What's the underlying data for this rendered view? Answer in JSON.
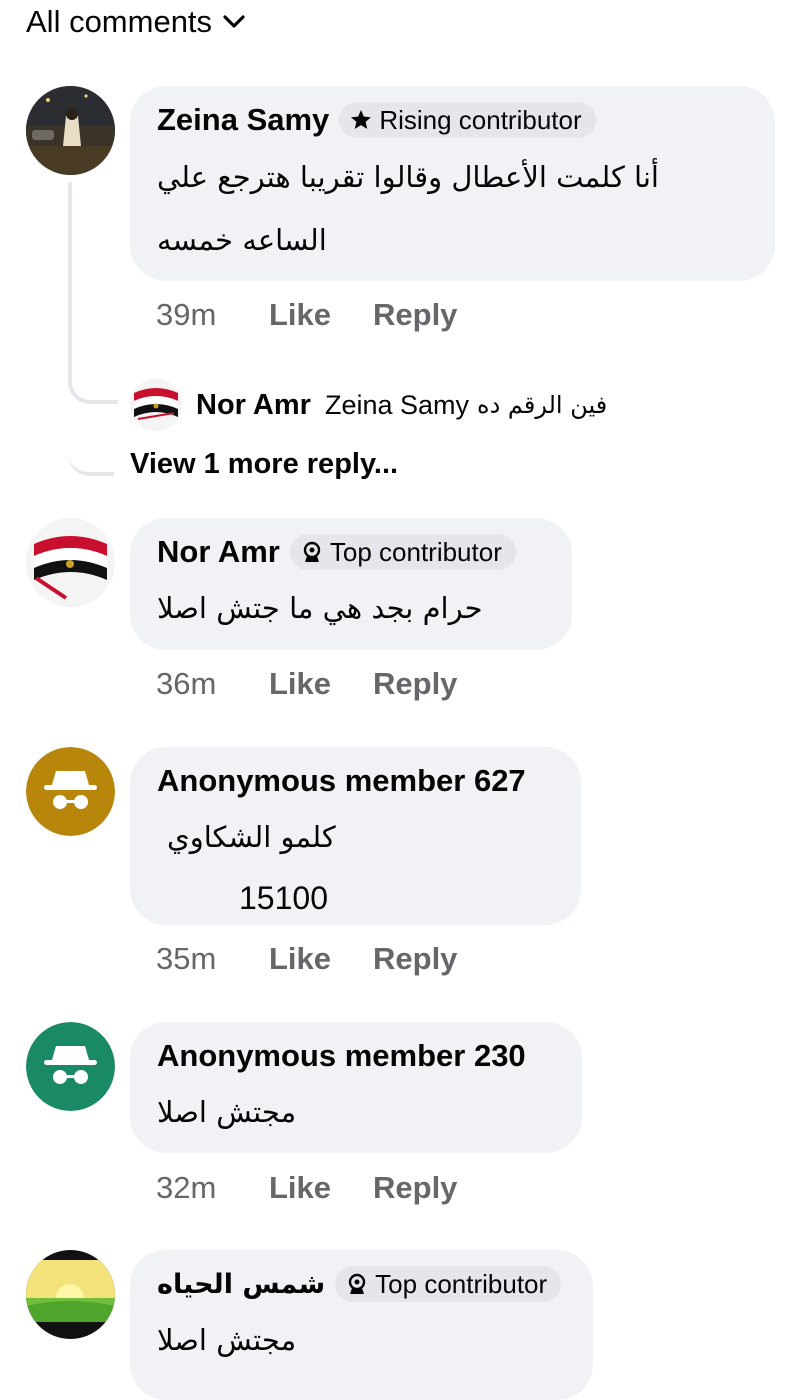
{
  "header": {
    "label": "All comments",
    "icon": "chevron-down-icon"
  },
  "comments": [
    {
      "author": "Zeina Samy",
      "badge": {
        "label": "Rising contributor",
        "icon": "star-icon"
      },
      "lines": [
        "أنا كلمت الأعطال وقالوا تقريبا هترجع علي",
        "الساعه خمسه"
      ],
      "time": "39m",
      "like": "Like",
      "reply": "Reply",
      "replies": {
        "preview": {
          "author": "Nor Amr",
          "mention": "Zeina Samy",
          "text": "فين الرقم ده"
        },
        "view_more": "View 1 more reply..."
      }
    },
    {
      "author": "Nor Amr",
      "badge": {
        "label": "Top contributor",
        "icon": "top-contributor-icon"
      },
      "lines": [
        "حرام بجد هي ما جتش اصلا"
      ],
      "time": "36m",
      "like": "Like",
      "reply": "Reply"
    },
    {
      "author": "Anonymous member 627",
      "lines": [
        "كلمو الشكاوي",
        "15100"
      ],
      "time": "35m",
      "like": "Like",
      "reply": "Reply",
      "avatar_color": "#b8860b"
    },
    {
      "author": "Anonymous member 230",
      "lines": [
        "مجتش اصلا"
      ],
      "time": "32m",
      "like": "Like",
      "reply": "Reply",
      "avatar_color": "#1a8a66"
    },
    {
      "author": "شمس الحياه",
      "badge": {
        "label": "Top contributor",
        "icon": "top-contributor-icon"
      },
      "lines": [
        "مجتش اصلا"
      ]
    }
  ],
  "colors": {
    "bubble": "#f0f2f5",
    "badge": "#e4e6eb",
    "meta": "#65676b",
    "text": "#050505"
  }
}
